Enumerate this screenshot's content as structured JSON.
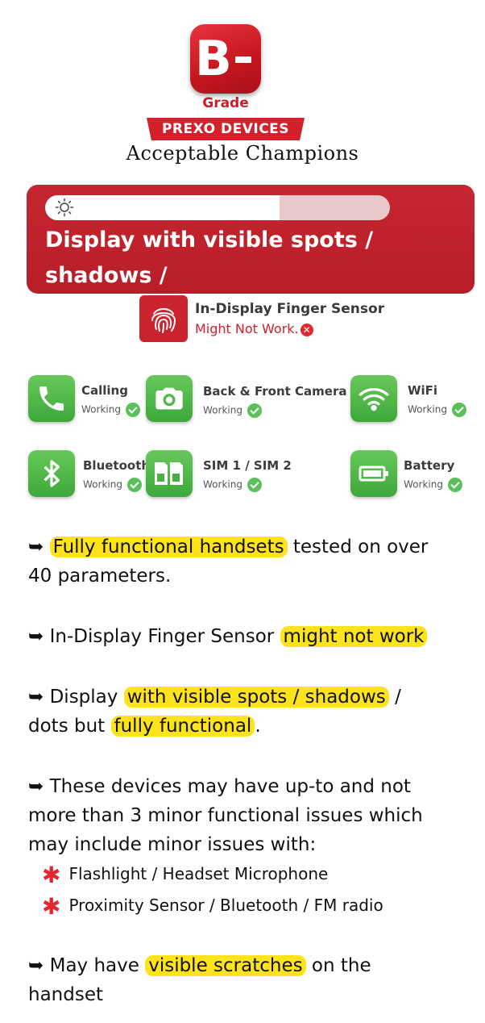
{
  "header": {
    "grade_letter": "B",
    "grade_word": "Grade",
    "ribbon": "PREXO DEVICES",
    "tagline": "Acceptable Champions"
  },
  "banner": {
    "brightness_fraction": 0.68,
    "text_line1": "Display with visible spots / shadows /",
    "text_line2": "dots but fully functional."
  },
  "finger_sensor": {
    "title": "In-Display Finger Sensor",
    "status": "Might Not Work."
  },
  "features": [
    {
      "title": "Calling",
      "status": "Working",
      "icon": "phone-icon"
    },
    {
      "title": "Back & Front Camera",
      "status": "Working",
      "icon": "camera-icon"
    },
    {
      "title": "WiFi",
      "status": "Working",
      "icon": "wifi-icon"
    },
    {
      "title": "Bluetooth",
      "status": "Working",
      "icon": "bluetooth-icon"
    },
    {
      "title": "SIM 1 / SIM 2",
      "status": "Working",
      "icon": "sim-icon"
    },
    {
      "title": "Battery",
      "status": "Working",
      "icon": "battery-icon"
    }
  ],
  "points": {
    "p1_hl": "Fully functional handsets",
    "p1_rest": " tested on over",
    "p1_line2": "40 parameters.",
    "p2_pre": "In-Display Finger Sensor",
    "p2_hl": "might not work",
    "p3_pre": "Display",
    "p3_hl": "with visible spots / shadows",
    "p3_post": " /",
    "p3_line2_pre": "dots but",
    "p3_line2_hl": "fully functional",
    "p3_line2_post": ".",
    "p4_line1": "These devices may have up-to and not",
    "p4_line2": "more than 3 minor functional  issues which",
    "p4_line3": "may include minor issues with:",
    "bullet1": "Flashlight / Headset Microphone",
    "bullet2": "Proximity Sensor / Bluetooth / FM radio",
    "p5_pre": "May have",
    "p5_hl": "visible scratches",
    "p5_post": " on the",
    "p5_line2": "handset",
    "arrow": "➥"
  },
  "colors": {
    "brand_red": "#c62630",
    "highlight": "#fde31c",
    "feature_green": "#4caf45"
  }
}
